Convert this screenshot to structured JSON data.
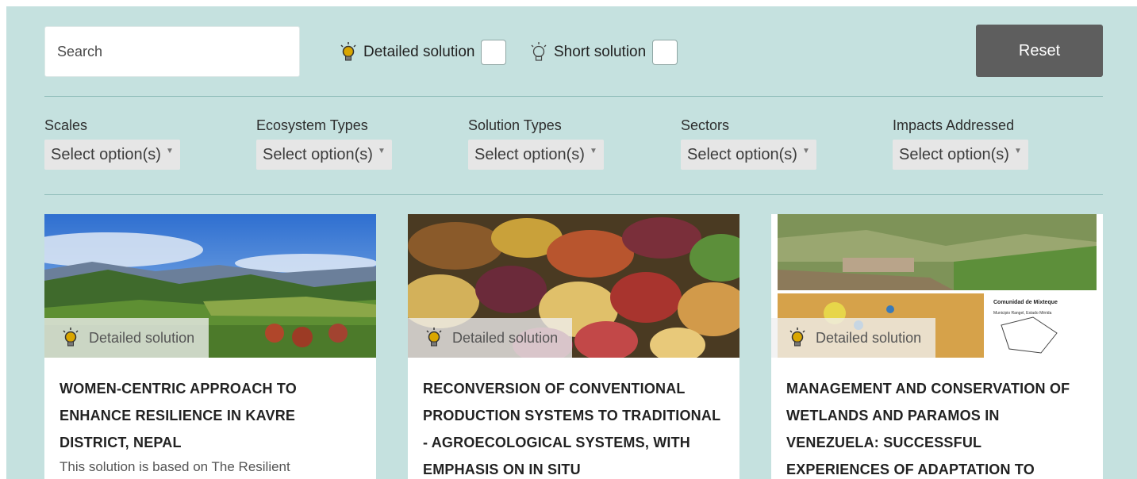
{
  "search": {
    "placeholder": "Search"
  },
  "toggles": {
    "detailed_label": "Detailed solution",
    "short_label": "Short solution"
  },
  "reset_label": "Reset",
  "filters": [
    {
      "label": "Scales",
      "value": "Select option(s)"
    },
    {
      "label": "Ecosystem Types",
      "value": "Select option(s)"
    },
    {
      "label": "Solution Types",
      "value": "Select option(s)"
    },
    {
      "label": "Sectors",
      "value": "Select option(s)"
    },
    {
      "label": "Impacts Addressed",
      "value": "Select option(s)"
    }
  ],
  "cards": [
    {
      "badge": "Detailed solution",
      "title": "WOMEN-CENTRIC APPROACH TO ENHANCE RESILIENCE IN KAVRE DISTRICT, NEPAL",
      "description": "This solution is based on The Resilient"
    },
    {
      "badge": "Detailed solution",
      "title": "RECONVERSION OF CONVENTIONAL PRODUCTION SYSTEMS TO TRADITIONAL - AGROECOLOGICAL SYSTEMS, WITH EMPHASIS ON IN SITU",
      "description": ""
    },
    {
      "badge": "Detailed solution",
      "title": "MANAGEMENT AND CONSERVATION OF WETLANDS AND PARAMOS IN VENEZUELA: SUCCESSFUL EXPERIENCES OF ADAPTATION TO",
      "description": "",
      "image_text": {
        "heading": "Comunidad de Mixteque",
        "subheading": "Municipio Rangel, Estado Mérida"
      }
    }
  ],
  "colors": {
    "panel_bg": "#c5e1df",
    "reset_bg": "#5e5e5e",
    "bulb": "#d9a600"
  }
}
